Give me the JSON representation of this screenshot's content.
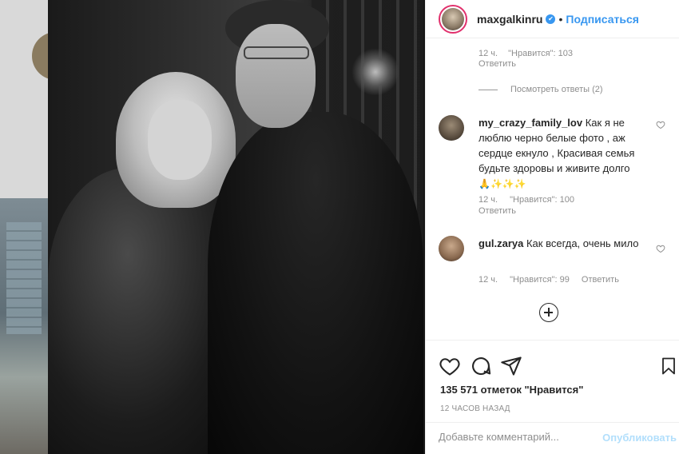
{
  "header": {
    "username": "maxgalkinru",
    "separator": "•",
    "follow_label": "Подписаться",
    "verified_icon": "verified-badge-icon"
  },
  "comments": {
    "top_meta": {
      "time": "12 ч.",
      "likes": "\"Нравится\": 103",
      "reply": "Ответить"
    },
    "view_replies": "Посмотреть ответы (2)",
    "items": [
      {
        "username": "my_crazy_family_lov",
        "text": "Как я не люблю черно белые фото , аж сердце екнуло , Красивая семья будьте здоровы и живите долго",
        "emoji": "🙏✨✨✨",
        "time": "12 ч.",
        "likes": "\"Нравится\": 100",
        "reply": "Ответить"
      },
      {
        "username": "gul.zarya",
        "text": "Как всегда, очень мило",
        "time": "12 ч.",
        "likes": "\"Нравится\": 99",
        "reply": "Ответить"
      }
    ]
  },
  "actions": {
    "likes_count": "135 571 отметок \"Нравится\"",
    "time_ago": "12 ЧАСОВ НАЗАД"
  },
  "add_comment": {
    "placeholder": "Добавьте комментарий...",
    "post_label": "Опубликовать"
  },
  "colors": {
    "accent": "#3897f0",
    "post_disabled": "#b2dffc",
    "muted": "#8e8e8e"
  }
}
